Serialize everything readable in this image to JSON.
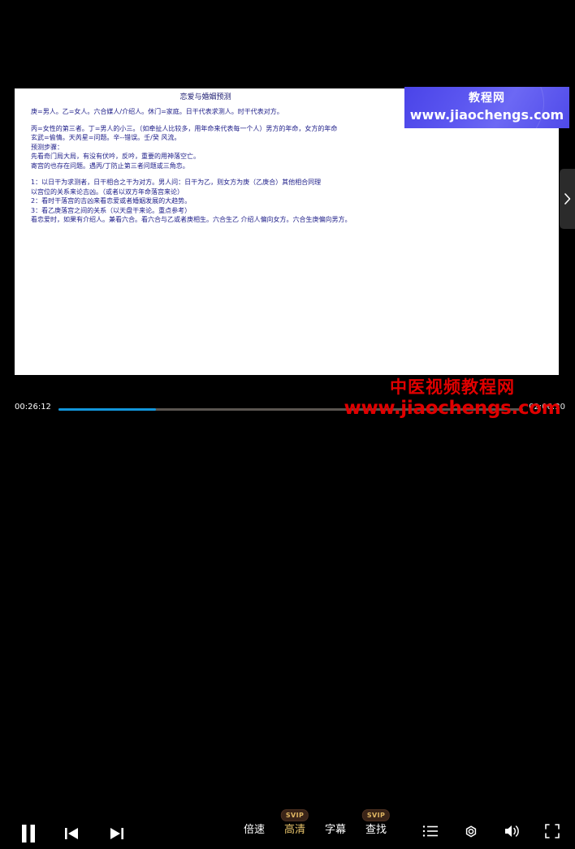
{
  "player": {
    "slide": {
      "title": "恋爱与婚姻预测",
      "paragraphs": [
        "庚=男人。乙=女人。六合媒人/介绍人。休门=家庭。日干代表求测人。时干代表对方。",
        "丙=女性的第三者。丁=男人的小三。（如牵扯人比较多，用年命来代表每一个人）男方的年命，女方的年命\n玄武=偷情。天芮星=问题。辛--错误。壬/癸 风流。\n预测步骤：\n先看奇门局大局，有没有伏吟，反吟，重要的用神落空亡。\n寄宫的也存在问题。遇丙/丁防止第三者问题或三角恋。",
        "1：以日干为求测者，日干相合之干为对方。男人问：日干为乙，则女方为庚（乙庚合）其他相合同理\n以宫位的关系来论吉凶。（或者以双方年命落宫来论）\n2：看时干落宫的吉凶来看恋爱或者婚姻发展的大趋势。\n3：看乙庚落宫之间的关系（以天盘干来论。重点参考）\n看恋爱时，如果有介绍人。兼看六合。看六合与乙或者庚相生。六合生乙 介绍人偏向女方。六合生庚偏向男方。"
      ]
    },
    "watermark_blue": {
      "name": "教程网",
      "url": "www.jiaochengs.com",
      "color": "#5b56f0"
    },
    "watermark_red": {
      "name": "中医视频教程网",
      "url": "www.jiaochengs.com",
      "color": "#e00000"
    },
    "side_handle": {
      "icon": "chevron-right-icon"
    },
    "controls": {
      "current_time": "00:26:12",
      "total_time": "02:06:30",
      "progress_percent": 21,
      "progress_color": "#1296db",
      "transport": [
        {
          "label": "暂停",
          "icon": "pause-icon"
        },
        {
          "label": "上一集",
          "icon": "previous-icon"
        },
        {
          "label": "下一集",
          "icon": "next-icon"
        }
      ],
      "center_buttons": [
        {
          "label": "倍速",
          "badge": "",
          "highlight": false
        },
        {
          "label": "高清",
          "badge": "SVIP",
          "highlight": true
        },
        {
          "label": "字幕",
          "badge": "",
          "highlight": false
        },
        {
          "label": "查找",
          "badge": "SVIP",
          "highlight": false
        }
      ],
      "right_buttons": [
        {
          "label": "播放列表",
          "icon": "playlist-icon"
        },
        {
          "label": "设置",
          "icon": "settings-icon"
        },
        {
          "label": "音量",
          "icon": "volume-icon"
        },
        {
          "label": "全屏",
          "icon": "fullscreen-icon"
        }
      ]
    }
  }
}
